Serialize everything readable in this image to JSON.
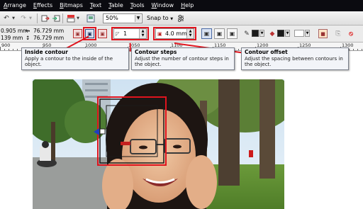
{
  "menu": {
    "items": [
      {
        "label": "Arrange",
        "underline": "A",
        "rest": "rrange"
      },
      {
        "label": "Effects",
        "underline": "E",
        "rest": "ffects"
      },
      {
        "label": "Bitmaps",
        "underline": "B",
        "rest": "itmaps"
      },
      {
        "label": "Text",
        "underline": "T",
        "rest": "ext"
      },
      {
        "label": "Table",
        "underline": "T",
        "rest": "able"
      },
      {
        "label": "Tools",
        "underline": "T",
        "rest": "ools"
      },
      {
        "label": "Window",
        "underline": "W",
        "rest": "indow"
      },
      {
        "label": "Help",
        "underline": "H",
        "rest": "elp"
      }
    ]
  },
  "toolbar": {
    "zoom_value": "50%",
    "snap_label": "Snap to"
  },
  "propbar": {
    "x_value": "0.905 mm",
    "y_value": "139 mm",
    "width_value": "76.729 mm",
    "height_value": "76.729 mm",
    "steps_value": "1",
    "offset_value": "4.0 mm"
  },
  "ruler": {
    "labels": [
      "900",
      "950",
      "1000",
      "1050",
      "1100",
      "1150",
      "1200",
      "1250",
      "1300"
    ]
  },
  "tooltips": {
    "inside": {
      "title": "Inside contour",
      "body": "Apply a contour to the inside of the object."
    },
    "steps": {
      "title": "Contour steps",
      "body": "Adjust the number of contour steps in the object."
    },
    "offset": {
      "title": "Contour offset",
      "body": "Adjust the spacing between contours in the object."
    }
  },
  "colors": {
    "highlight_red": "#e0141e",
    "menubar_bg": "#0b0b10"
  }
}
